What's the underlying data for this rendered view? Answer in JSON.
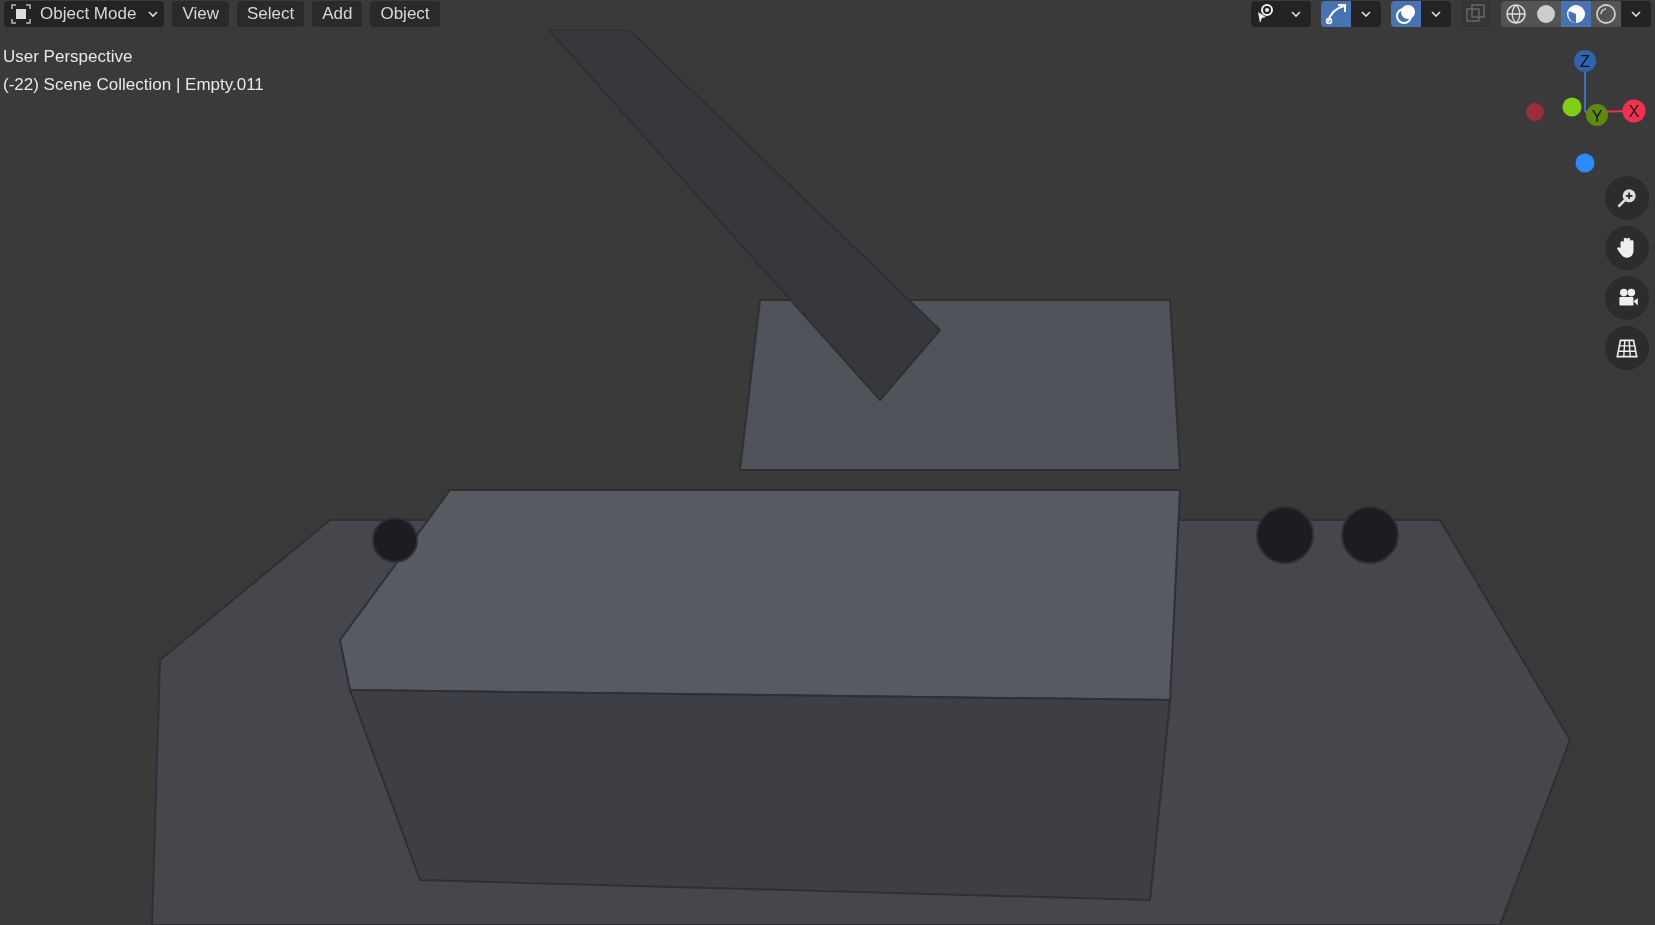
{
  "header": {
    "mode_menu": {
      "label": "Object Mode"
    },
    "menus": [
      "View",
      "Select",
      "Add",
      "Object"
    ],
    "toggles": [
      {
        "kind": "visibility",
        "selected": false
      },
      {
        "kind": "gizmos",
        "selected": true
      },
      {
        "kind": "overlays",
        "selected": true
      },
      {
        "kind": "xray",
        "selected": false
      }
    ],
    "shading": [
      {
        "kind": "wireframe",
        "selected": false
      },
      {
        "kind": "solid",
        "selected": false
      },
      {
        "kind": "material",
        "selected": true
      },
      {
        "kind": "rendered",
        "selected": false
      }
    ]
  },
  "viewport_info": [
    "User Perspective",
    "(-22) Scene Collection | Empty.011"
  ],
  "gizmo": {
    "axes": [
      "Z",
      "Y",
      "X"
    ]
  },
  "navigation": [
    {
      "kind": "zoom"
    },
    {
      "kind": "pan"
    },
    {
      "kind": "camera"
    },
    {
      "kind": "ortho"
    }
  ]
}
